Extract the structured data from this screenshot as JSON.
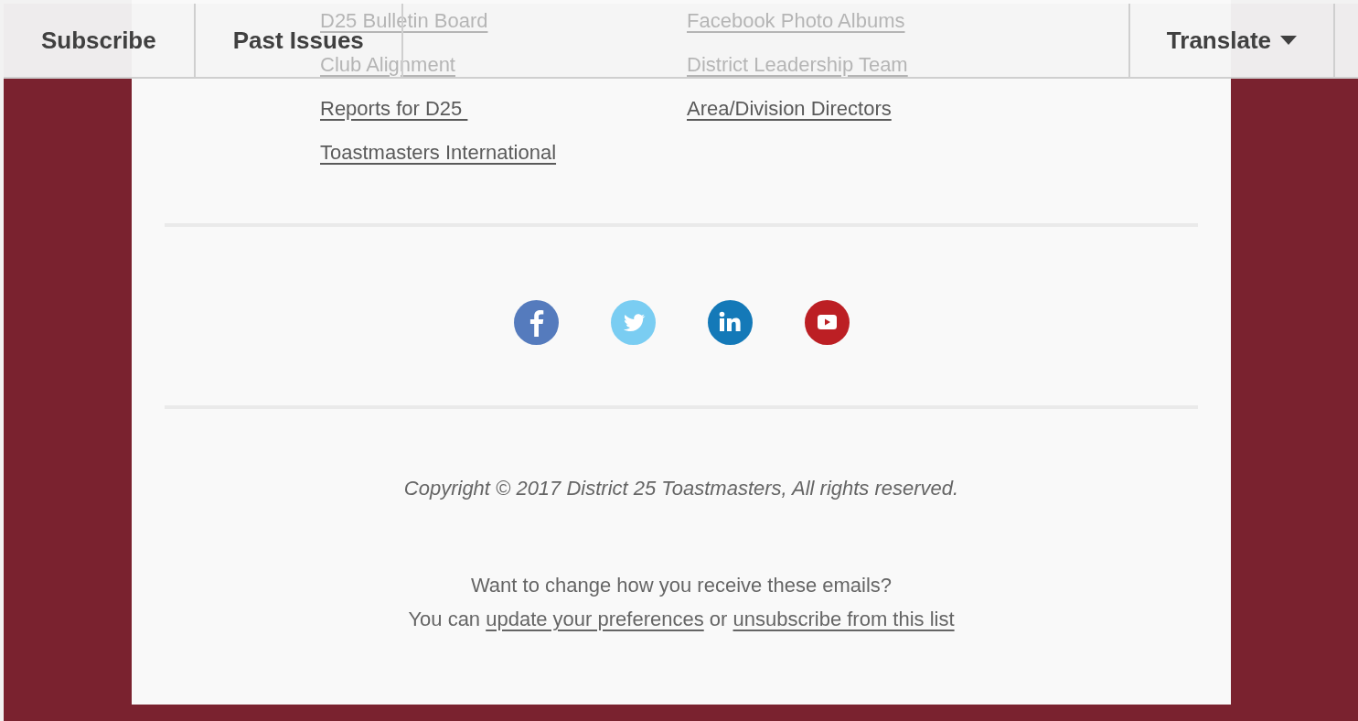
{
  "nav": {
    "items": [
      {
        "label": "Subscribe"
      },
      {
        "label": "Past Issues"
      }
    ],
    "translate": {
      "label": "Translate"
    }
  },
  "links": {
    "column_1": [
      "D25 Bulletin Board",
      "Club Alignment",
      "Reports for D25 ",
      "Toastmasters International"
    ],
    "column_2": [
      "Facebook Photo Albums",
      "District Leadership Team",
      "Area/Division Directors"
    ]
  },
  "social": [
    {
      "kind": "facebook",
      "color": "#557bbd"
    },
    {
      "kind": "twitter",
      "color": "#7acdf2"
    },
    {
      "kind": "linkedin",
      "color": "#1479b8"
    },
    {
      "kind": "youtube",
      "color": "#bc1f24"
    }
  ],
  "copyright": "Copyright © 2017 District 25 Toastmasters, All rights reserved.",
  "footer": {
    "question": "Want to change how you receive these emails?",
    "lead": "You can",
    "preferences_link": "update your preferences",
    "joiner": "or",
    "unsubscribe_link": "unsubscribe from this list"
  }
}
